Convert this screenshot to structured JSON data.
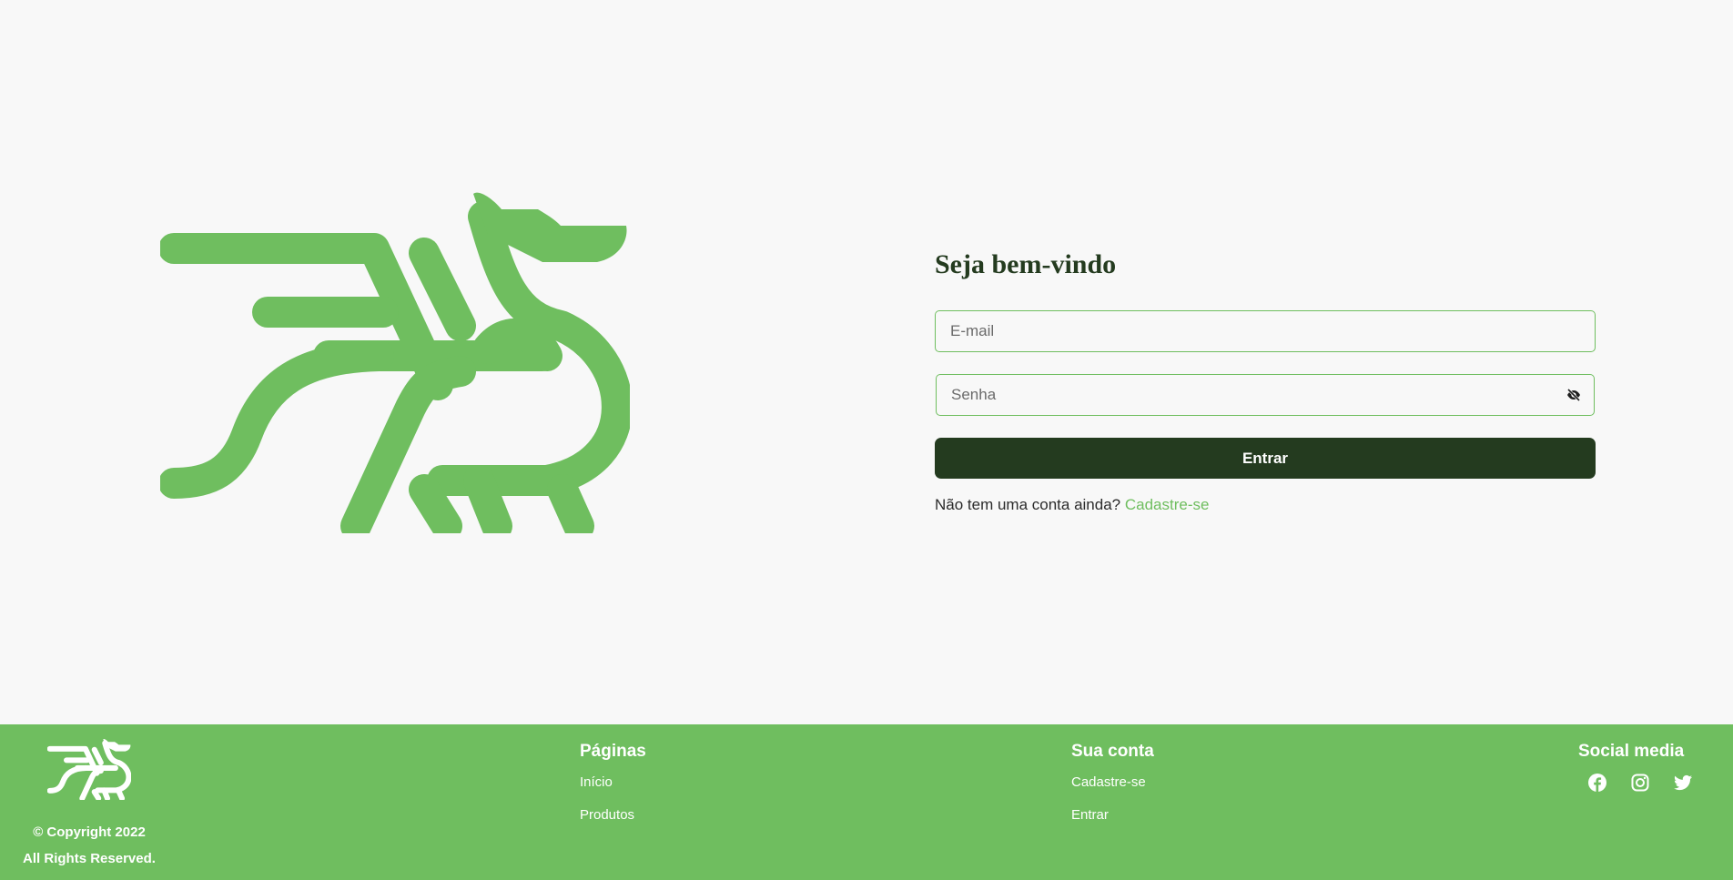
{
  "login": {
    "title": "Seja bem-vindo",
    "email_placeholder": "E-mail",
    "password_placeholder": "Senha",
    "submit_label": "Entrar",
    "signup_prompt": "Não tem uma conta ainda?",
    "signup_link": "Cadastre-se"
  },
  "footer": {
    "copyright": "© Copyright 2022",
    "rights": "All Rights Reserved.",
    "pages": {
      "heading": "Páginas",
      "links": [
        "Início",
        "Produtos"
      ]
    },
    "account": {
      "heading": "Sua conta",
      "links": [
        "Cadastre-se",
        "Entrar"
      ]
    },
    "social": {
      "heading": "Social media",
      "icons": [
        "facebook-icon",
        "instagram-icon",
        "twitter-icon"
      ]
    }
  },
  "colors": {
    "brand_green": "#6fbe5f",
    "dark_green": "#243b1f",
    "background": "#f8f8f8"
  }
}
